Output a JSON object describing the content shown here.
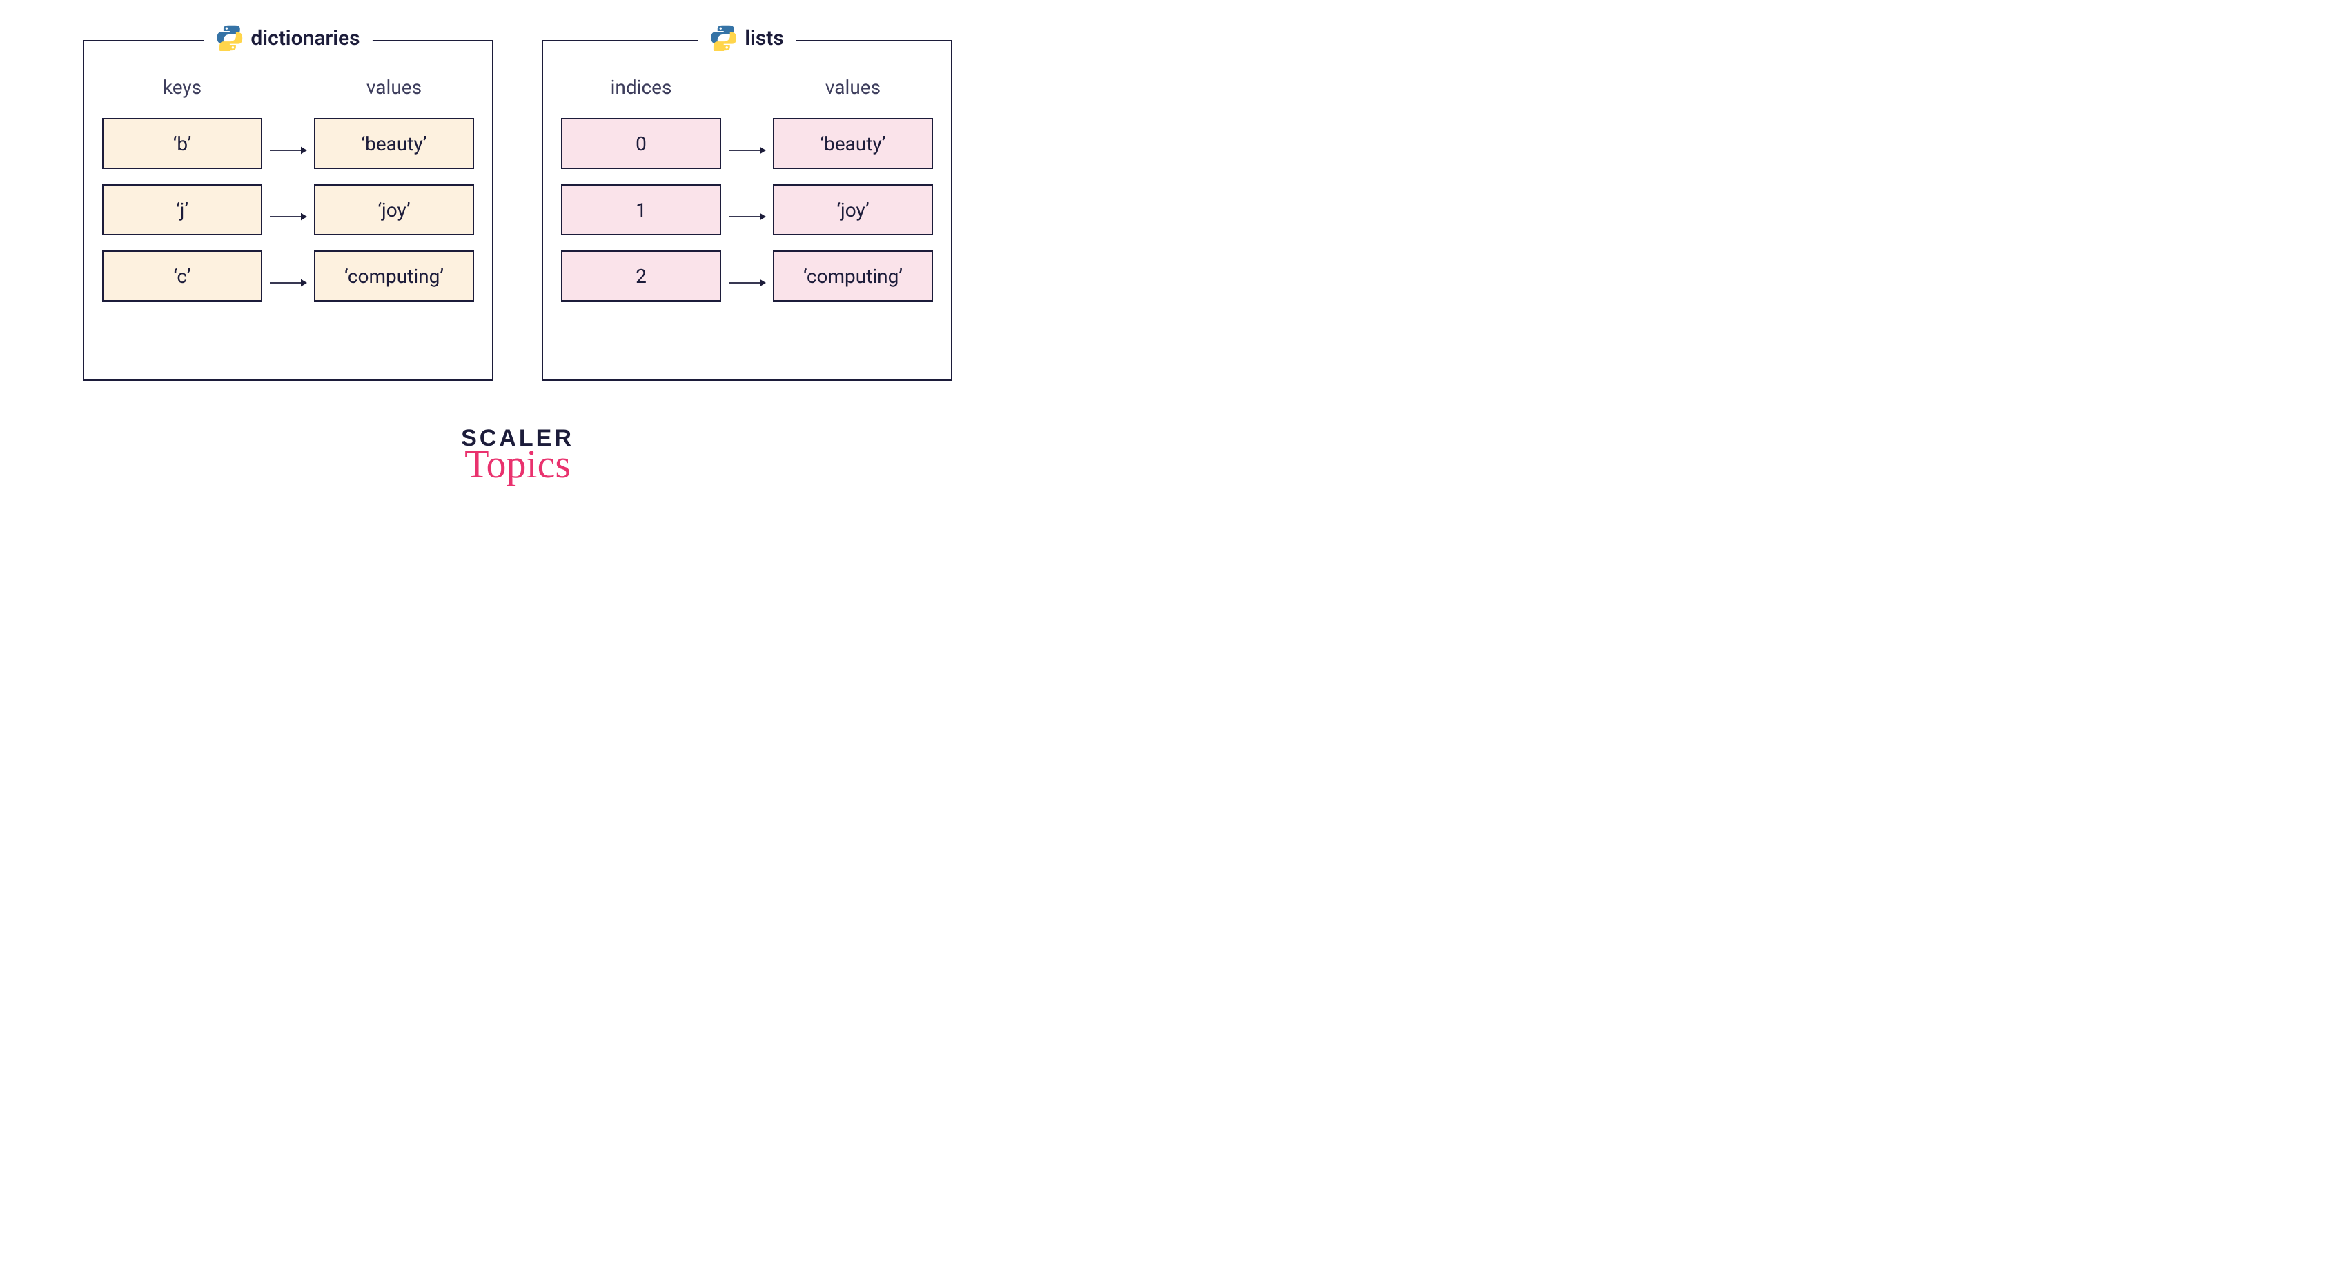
{
  "panels": {
    "dict": {
      "title": "dictionaries",
      "left_heading": "keys",
      "right_heading": "values",
      "rows": [
        {
          "key": "‘b’",
          "value": "‘beauty’"
        },
        {
          "key": "‘j’",
          "value": "‘joy’"
        },
        {
          "key": "‘c’",
          "value": "‘computing’"
        }
      ],
      "cell_color": "cream"
    },
    "list": {
      "title": "lists",
      "left_heading": "indices",
      "right_heading": "values",
      "rows": [
        {
          "key": "0",
          "value": "‘beauty’"
        },
        {
          "key": "1",
          "value": "‘joy’"
        },
        {
          "key": "2",
          "value": "‘computing’"
        }
      ],
      "cell_color": "pink"
    }
  },
  "footer": {
    "brand_main": "SCALER",
    "brand_sub": "Topics"
  },
  "colors": {
    "border": "#1c1c3a",
    "cream": "#fdf1df",
    "pink": "#fae3ea",
    "accent_pink": "#e9326e",
    "python_blue": "#3573a6",
    "python_yellow": "#ffd54b"
  }
}
